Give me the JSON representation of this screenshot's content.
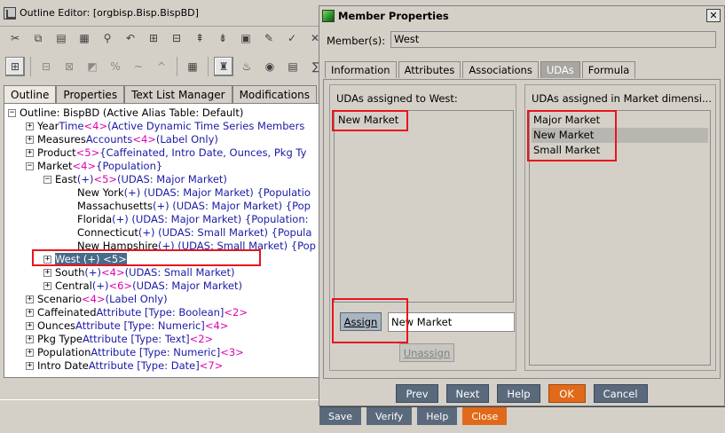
{
  "outline_editor": {
    "title": "Outline Editor: [orgbisp.Bisp.BispBD]",
    "tabs": [
      "Outline",
      "Properties",
      "Text List Manager",
      "Modifications"
    ],
    "tree": {
      "root": "Outline: BispBD (Active Alias Table: Default)",
      "rows": [
        {
          "name": "Year",
          "desc": " Time ",
          "count": "<4>",
          "rest": " (Active Dynamic Time Series Members"
        },
        {
          "name": "Measures",
          "desc": " Accounts ",
          "count": "<4>",
          "rest": " (Label Only)"
        },
        {
          "name": "Product",
          "desc": " ",
          "count": "<5>",
          "rest": " {Caffeinated, Intro Date, Ounces, Pkg Ty"
        },
        {
          "name": "Market",
          "desc": " ",
          "count": "<4>",
          "rest": " {Population}"
        },
        {
          "name": "East",
          "desc": " (+) ",
          "count": "<5>",
          "rest": " (UDAS: Major Market)"
        },
        {
          "name": "New York",
          "desc": " (+) (UDAS: Major Market) {Populatio"
        },
        {
          "name": "Massachusetts",
          "desc": " (+) (UDAS: Major Market) {Pop"
        },
        {
          "name": "Florida",
          "desc": " (+) (UDAS: Major Market) {Population:"
        },
        {
          "name": "Connecticut",
          "desc": " (+) (UDAS: Small Market) {Popula"
        },
        {
          "name": "New Hampshire",
          "desc": " (+) (UDAS: Small Market) {Pop"
        },
        {
          "name": "West (+) <5>"
        },
        {
          "name": "South",
          "desc": " (+) ",
          "count": "<4>",
          "rest": " (UDAS: Small Market)"
        },
        {
          "name": "Central",
          "desc": " (+) ",
          "count": "<6>",
          "rest": " (UDAS: Major Market)"
        },
        {
          "name": "Scenario",
          "desc": " ",
          "count": "<4>",
          "rest": " (Label Only)"
        },
        {
          "name": "Caffeinated",
          "desc": " Attribute [Type: Boolean] ",
          "count": "<2>"
        },
        {
          "name": "Ounces",
          "desc": " Attribute [Type: Numeric] ",
          "count": "<4>"
        },
        {
          "name": "Pkg Type",
          "desc": " Attribute [Type: Text] ",
          "count": "<2>"
        },
        {
          "name": "Population",
          "desc": " Attribute [Type: Numeric] ",
          "count": "<3>"
        },
        {
          "name": "Intro Date",
          "desc": " Attribute [Type: Date] ",
          "count": "<7>"
        }
      ]
    },
    "bottom_buttons": {
      "save": "Save",
      "verify": "Verify",
      "help": "Help",
      "close": "Close"
    }
  },
  "dialog": {
    "title": "Member Properties",
    "close_glyph": "✕",
    "members_label": "Member(s):",
    "members_value": "West",
    "tabs": [
      "Information",
      "Attributes",
      "Associations",
      "UDAs",
      "Formula"
    ],
    "active_tab": "UDAs",
    "left_panel": {
      "title": "UDAs assigned to West:",
      "items": [
        "New Market"
      ],
      "assign_label": "Assign",
      "assign_value": "New Market",
      "unassign_label": "Unassign"
    },
    "right_panel": {
      "title": "UDAs assigned in Market dimensi...",
      "items": [
        "Major Market",
        "New Market",
        "Small Market"
      ],
      "selected": "New Market"
    },
    "footer": {
      "prev": "Prev",
      "next": "Next",
      "help": "Help",
      "ok": "OK",
      "cancel": "Cancel"
    }
  },
  "colors": {
    "highlight_red": "#e8151c",
    "button_slate": "#5a6a7c",
    "button_orange": "#e06a1a",
    "tree_blue": "#1a1aa6",
    "tree_pink": "#e000b0"
  }
}
